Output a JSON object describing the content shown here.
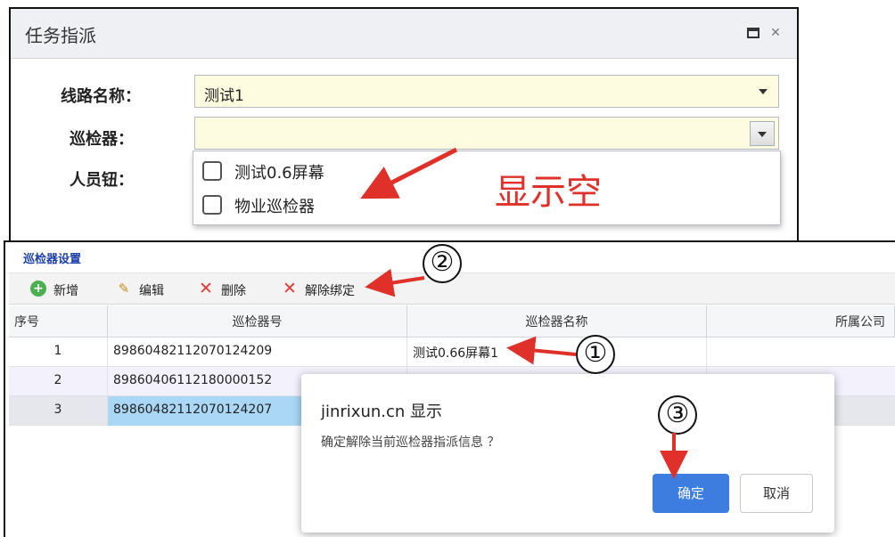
{
  "task_dialog": {
    "title": "任务指派",
    "route_label": "线路名称：",
    "route_value": "测试1",
    "inspector_label": "巡检器：",
    "inspector_value": "",
    "person_label": "人员钮：",
    "dropdown_options": [
      "测试0.6屏幕",
      "物业巡检器"
    ]
  },
  "panel": {
    "title": "巡检器设置",
    "toolbar": [
      {
        "label": "新增",
        "icon": "add-icon"
      },
      {
        "label": "编辑",
        "icon": "edit-icon"
      },
      {
        "label": "删除",
        "icon": "delete-icon"
      },
      {
        "label": "解除绑定",
        "icon": "unbind-icon"
      }
    ],
    "columns": [
      "序号",
      "巡检器号",
      "巡检器名称",
      "所属公司"
    ],
    "rows": [
      {
        "index": "1",
        "number": "89860482112070124209",
        "name": "测试0.66屏幕1",
        "company": ""
      },
      {
        "index": "2",
        "number": "89860406112180000152",
        "name": "",
        "company": ""
      },
      {
        "index": "3",
        "number": "89860482112070124207",
        "name": "",
        "company": ""
      }
    ],
    "selected_row": 3
  },
  "confirm_dialog": {
    "title": "jinrixun.cn 显示",
    "message": "确定解除当前巡检器指派信息 ？",
    "ok_label": "确定",
    "cancel_label": "取消"
  },
  "annotations": {
    "empty_note": "显示空",
    "step1": "①",
    "step2": "②",
    "step3": "③"
  },
  "colors": {
    "annotation_red": "#e0302a",
    "field_bg": "#fdfbe0",
    "selected_row": "#a9d7f5",
    "ok_button": "#3c7ddf",
    "panel_title": "#1d3fa8"
  }
}
